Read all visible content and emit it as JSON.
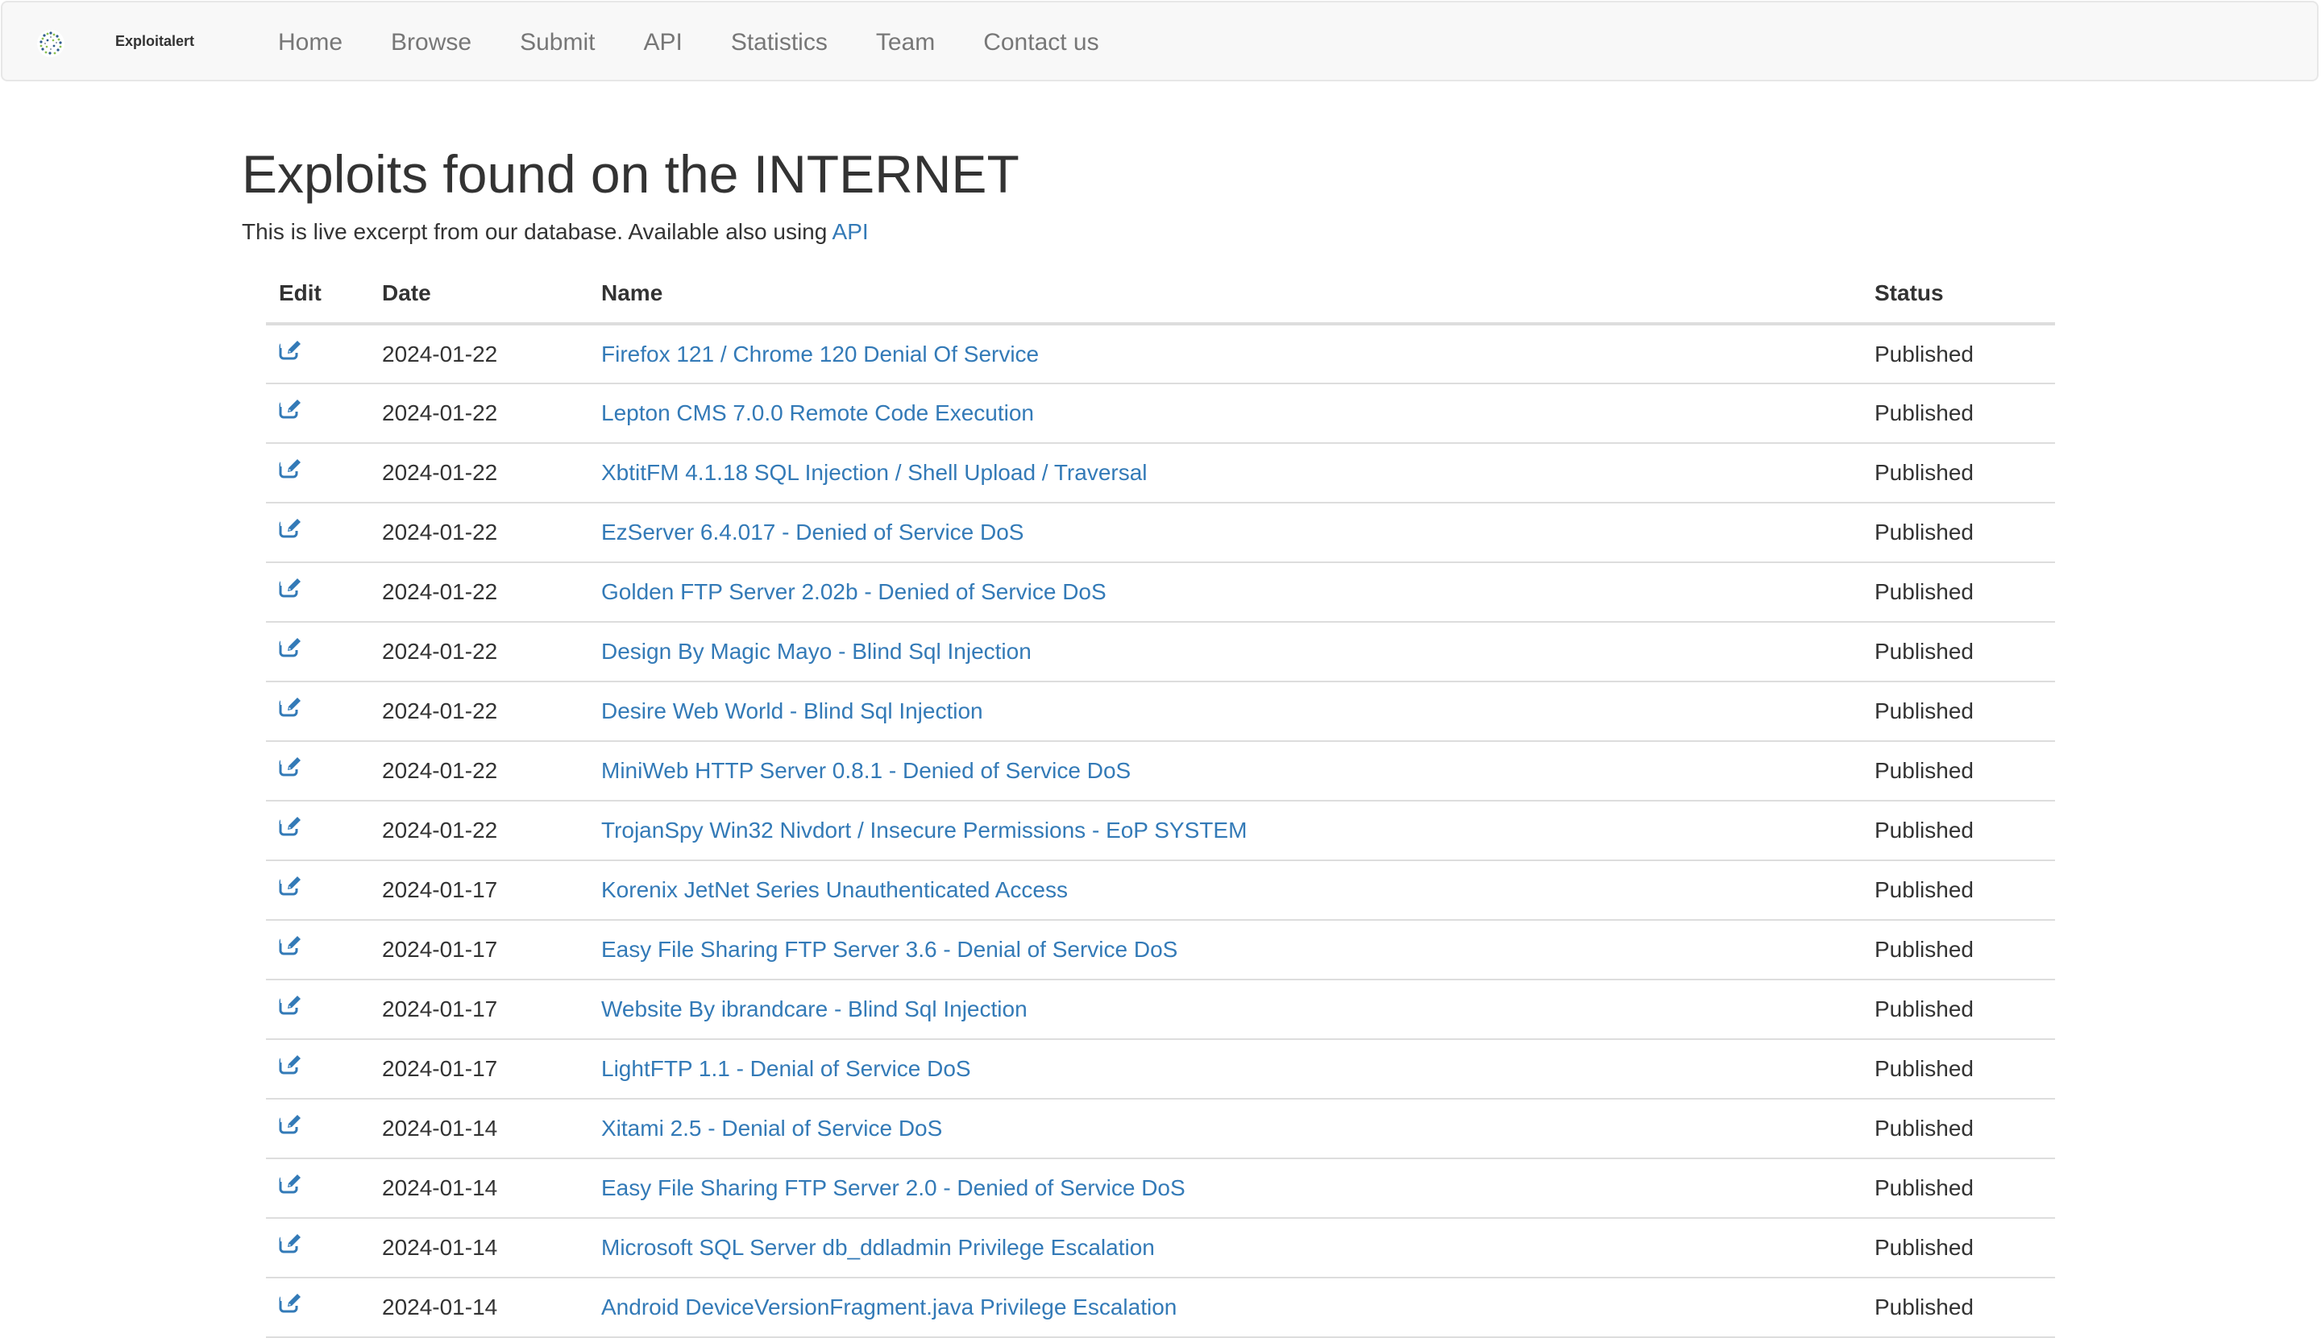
{
  "navbar": {
    "brand": "Exploitalert",
    "links": [
      "Home",
      "Browse",
      "Submit",
      "API",
      "Statistics",
      "Team",
      "Contact us"
    ]
  },
  "page": {
    "title": "Exploits found on the INTERNET",
    "lead_text": "This is live excerpt from our database. Available also using ",
    "lead_link": "API"
  },
  "table": {
    "headers": [
      "Edit",
      "Date",
      "Name",
      "Status"
    ],
    "rows": [
      {
        "date": "2024-01-22",
        "name": "Firefox 121 / Chrome 120 Denial Of Service",
        "status": "Published"
      },
      {
        "date": "2024-01-22",
        "name": "Lepton CMS 7.0.0 Remote Code Execution",
        "status": "Published"
      },
      {
        "date": "2024-01-22",
        "name": "XbtitFM 4.1.18 SQL Injection / Shell Upload / Traversal",
        "status": "Published"
      },
      {
        "date": "2024-01-22",
        "name": "EzServer 6.4.017 - Denied of Service DoS",
        "status": "Published"
      },
      {
        "date": "2024-01-22",
        "name": "Golden FTP Server 2.02b - Denied of Service DoS",
        "status": "Published"
      },
      {
        "date": "2024-01-22",
        "name": "Design By Magic Mayo - Blind Sql Injection",
        "status": "Published"
      },
      {
        "date": "2024-01-22",
        "name": "Desire Web World - Blind Sql Injection",
        "status": "Published"
      },
      {
        "date": "2024-01-22",
        "name": "MiniWeb HTTP Server 0.8.1 - Denied of Service DoS",
        "status": "Published"
      },
      {
        "date": "2024-01-22",
        "name": "TrojanSpy Win32 Nivdort / Insecure Permissions - EoP SYSTEM",
        "status": "Published"
      },
      {
        "date": "2024-01-17",
        "name": "Korenix JetNet Series Unauthenticated Access",
        "status": "Published"
      },
      {
        "date": "2024-01-17",
        "name": "Easy File Sharing FTP Server 3.6 - Denial of Service DoS",
        "status": "Published"
      },
      {
        "date": "2024-01-17",
        "name": "Website By ibrandcare - Blind Sql Injection",
        "status": "Published"
      },
      {
        "date": "2024-01-17",
        "name": "LightFTP 1.1 - Denial of Service DoS",
        "status": "Published"
      },
      {
        "date": "2024-01-14",
        "name": "Xitami 2.5 - Denial of Service DoS",
        "status": "Published"
      },
      {
        "date": "2024-01-14",
        "name": "Easy File Sharing FTP Server 2.0 - Denied of Service DoS",
        "status": "Published"
      },
      {
        "date": "2024-01-14",
        "name": "Microsoft SQL Server db_ddladmin Privilege Escalation",
        "status": "Published"
      },
      {
        "date": "2024-01-14",
        "name": "Android DeviceVersionFragment.java Privilege Escalation",
        "status": "Published"
      }
    ]
  },
  "colors": {
    "link": "#337ab7",
    "text": "#333333",
    "nav_text": "#777777",
    "nav_bg": "#f8f8f8",
    "border": "#dddddd"
  }
}
